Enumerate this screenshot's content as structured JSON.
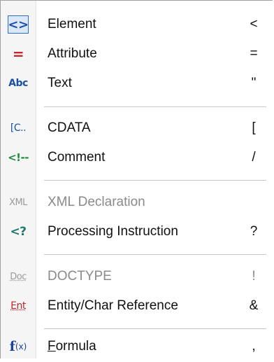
{
  "menu": {
    "items": [
      {
        "label": "Element",
        "shortcut": "<",
        "icon": "element-icon",
        "icon_text": "<>",
        "enabled": true,
        "selected": true
      },
      {
        "label": "Attribute",
        "shortcut": "=",
        "icon": "attribute-icon",
        "icon_text": "=",
        "enabled": true
      },
      {
        "label": "Text",
        "shortcut": "\"",
        "icon": "text-icon",
        "icon_text": "Abc",
        "enabled": true
      },
      {
        "label": "CDATA",
        "shortcut": "[",
        "icon": "cdata-icon",
        "icon_text": "[C..",
        "enabled": true
      },
      {
        "label": "Comment",
        "shortcut": "/",
        "icon": "comment-icon",
        "icon_text": "<!--",
        "enabled": true
      },
      {
        "label": "XML Declaration",
        "shortcut": "",
        "icon": "xml-declaration-icon",
        "icon_text": "XML",
        "enabled": false
      },
      {
        "label": "Processing Instruction",
        "shortcut": "?",
        "icon": "processing-instruction-icon",
        "icon_text": "<?",
        "enabled": true
      },
      {
        "label": "DOCTYPE",
        "shortcut": "!",
        "icon": "doctype-icon",
        "icon_text": "Doc",
        "enabled": false
      },
      {
        "label": "Entity/Char Reference",
        "shortcut": "&",
        "icon": "entity-icon",
        "icon_text": "Ent",
        "enabled": true
      },
      {
        "label_prefix": "F",
        "label_rest": "ormula",
        "shortcut": ",",
        "icon": "formula-icon",
        "icon_text_f": "f",
        "icon_text_x": "(x)",
        "enabled": true
      }
    ]
  },
  "colors": {
    "element": "#1b4fa8",
    "attribute": "#c0282d",
    "text": "#1b4fa8",
    "cdata": "#1b4fa8",
    "comment": "#1f8a3a",
    "disabled": "#9a9a9a",
    "processing": "#1f7a6e",
    "entity": "#c0282d",
    "formula": "#1b3f9a"
  }
}
